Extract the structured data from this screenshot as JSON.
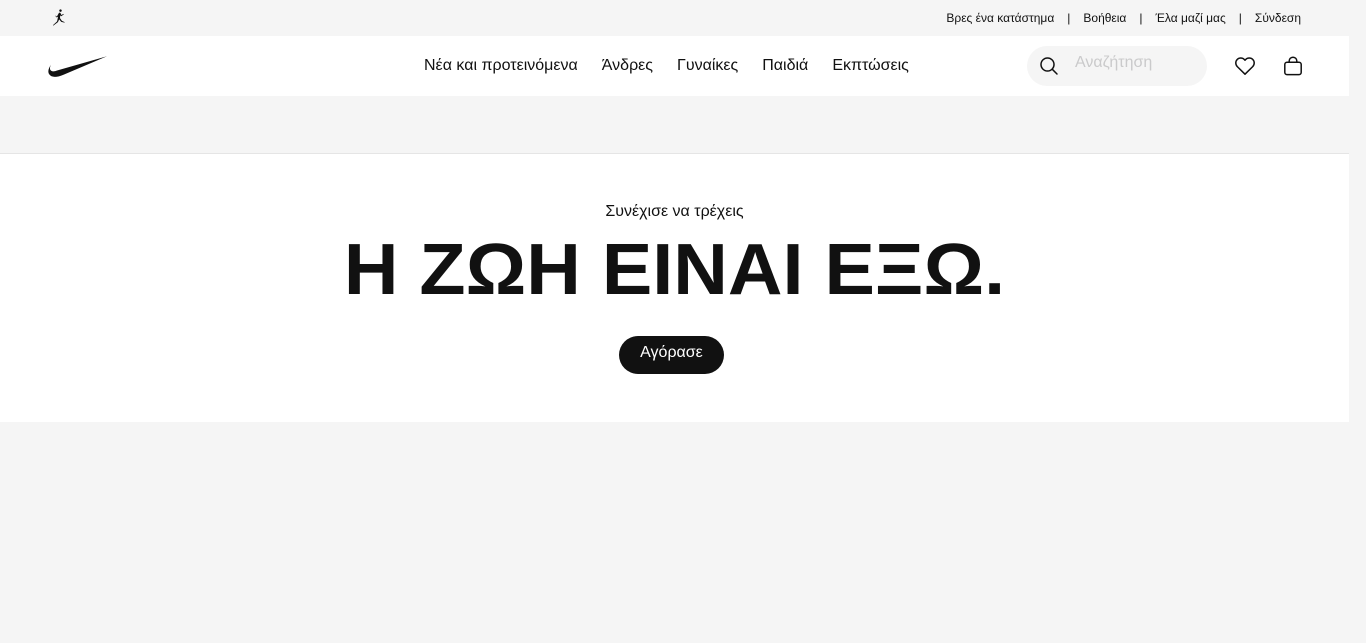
{
  "utility_bar": {
    "links": [
      "Βρες ένα κατάστημα",
      "Βοήθεια",
      "Έλα μαζί μας",
      "Σύνδεση"
    ],
    "separator": "|"
  },
  "header": {
    "nav": [
      "Νέα και προτεινόμενα",
      "Άνδρες",
      "Γυναίκες",
      "Παιδιά",
      "Εκπτώσεις"
    ],
    "search": {
      "placeholder": "Αναζήτηση"
    }
  },
  "hero": {
    "eyebrow": "Συνέχισε να τρέχεις",
    "title": "Η ΖΩΗ ΕΙΝΑΙ ΕΞΩ.",
    "cta": "Αγόρασε"
  },
  "icons": [
    "jordan-jumpman",
    "nike-swoosh",
    "search",
    "heart",
    "bag"
  ],
  "colors": {
    "accent": "#111111",
    "background": "#f5f5f5",
    "surface": "#ffffff",
    "placeholder": "#cacacb"
  }
}
